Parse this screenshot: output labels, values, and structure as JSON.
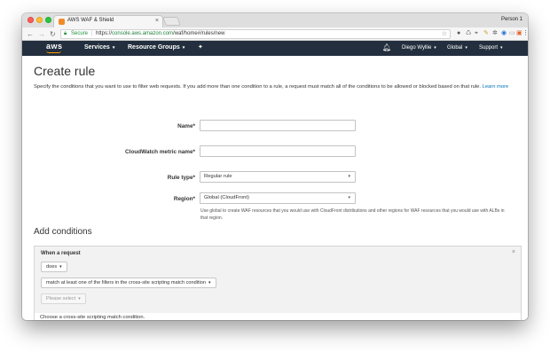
{
  "browser": {
    "tab_title": "AWS WAF & Shield",
    "tab_close": "×",
    "profile": "Person 1",
    "secure_label": "Secure",
    "url_prefix": "https://",
    "url_host": "console.aws.amazon.com",
    "url_path": "/waf/home#/rules/new",
    "icons": [
      "star-icon",
      "extension-icon",
      "extension-icon",
      "extension-icon",
      "extension-icon",
      "extension-icon",
      "extension-icon",
      "extension-icon",
      "extension-icon",
      "menu-icon"
    ]
  },
  "aws_nav": {
    "logo": "aws",
    "services": "Services",
    "resource_groups": "Resource Groups",
    "user": "Diego Wyllie",
    "region": "Global",
    "support": "Support",
    "caret": "▾"
  },
  "page": {
    "title": "Create rule",
    "intro": "Specify the conditions that you want to use to filter web requests. If you add more than one condition to a rule, a request must match all of the conditions to be allowed or blocked based on that rule.",
    "learn_more": "Learn more"
  },
  "form": {
    "name_label": "Name*",
    "name_value": "",
    "metric_label": "CloudWatch metric name*",
    "metric_value": "",
    "rule_type_label": "Rule type*",
    "rule_type_value": "Regular rule",
    "region_label": "Region*",
    "region_value": "Global (CloudFront)",
    "region_help": "Use global to create WAF resources that you would use with CloudFront distributions and other regions for WAF resources that you would use with ALBs in that region."
  },
  "conditions": {
    "section_title": "Add conditions",
    "when_label": "When a request",
    "close": "×",
    "does": "does",
    "match_type": "match at least one of the filters in the cross-site scripting match condition",
    "select_placeholder": "Please select",
    "footer": "Choose a cross-site scripting match condition."
  }
}
